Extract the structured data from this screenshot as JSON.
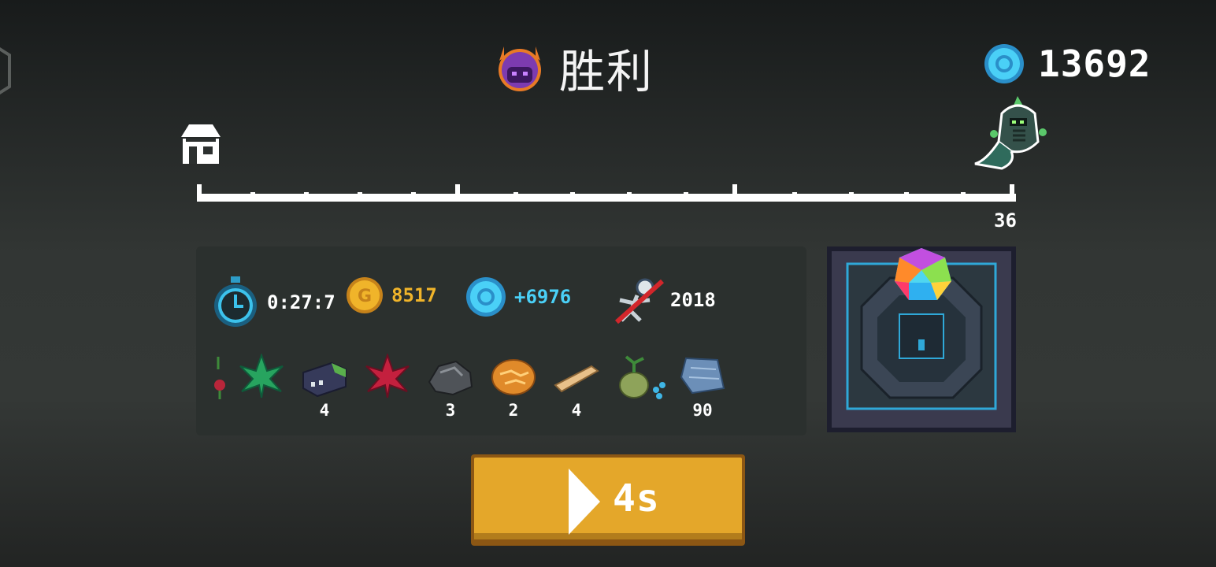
{
  "header": {
    "title": "胜利",
    "gem_total": "13692"
  },
  "progress": {
    "level": "36",
    "fraction": 1.0
  },
  "stats": {
    "time": "0:27:7",
    "gold": "8517",
    "gems": "+6976",
    "kills": "2018"
  },
  "loot": {
    "items": [
      {
        "icon": "red-flower-sprout-icon",
        "count": ""
      },
      {
        "icon": "green-leaf-icon",
        "count": ""
      },
      {
        "icon": "battery-brick-icon",
        "count": "4"
      },
      {
        "icon": "red-maple-leaf-icon",
        "count": ""
      },
      {
        "icon": "coal-rock-icon",
        "count": "3"
      },
      {
        "icon": "amber-ore-icon",
        "count": "2"
      },
      {
        "icon": "wood-plank-icon",
        "count": "4"
      },
      {
        "icon": "seed-sprout-icon",
        "count": ""
      },
      {
        "icon": "blue-cloth-icon",
        "count": "90"
      }
    ]
  },
  "actions": {
    "continue_label": "4s"
  },
  "colors": {
    "button": "#e4a72a",
    "button_border": "#8c5714",
    "gem": "#3fc3f0",
    "gold": "#f0b42a",
    "panel": "#2b302e"
  }
}
